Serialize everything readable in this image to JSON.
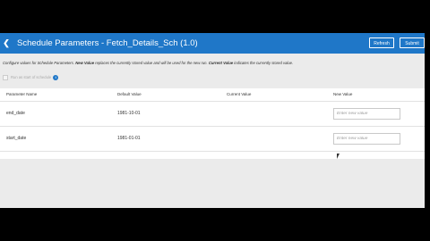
{
  "header": {
    "back_icon": "chevron-left-icon",
    "title": "Schedule Parameters - Fetch_Details_Sch (1.0)",
    "refresh_label": "Refresh",
    "submit_label": "Submit",
    "accent_color": "#1f77c8"
  },
  "description": {
    "part1": "Configure values for Schedule Parameters. ",
    "new_value_term": "New Value",
    "part2": " replaces the currently stored value and will be used for the new run. ",
    "current_value_term": "Current Value",
    "part3": " indicates the currently stored value."
  },
  "start_option": {
    "label": "Run as start of schedule",
    "checked": false,
    "info_icon": "info-icon"
  },
  "table": {
    "columns": [
      "Parameter Name",
      "Default Value",
      "Current Value",
      "New Value"
    ],
    "rows": [
      {
        "name": "end_date",
        "default": "1981-10-01",
        "current": "",
        "new_placeholder": "Enter new value"
      },
      {
        "name": "start_date",
        "default": "1981-01-01",
        "current": "",
        "new_placeholder": "Enter new value"
      }
    ]
  }
}
